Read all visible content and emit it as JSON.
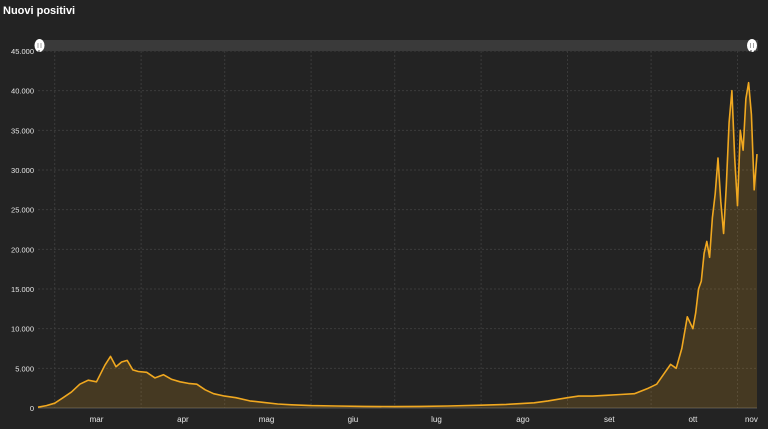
{
  "title": "Nuovi positivi",
  "chart_data": {
    "type": "area",
    "title": "Nuovi positivi",
    "xlabel": "",
    "ylabel": "",
    "x_tick_labels": [
      "mar",
      "apr",
      "mag",
      "giu",
      "lug",
      "ago",
      "set",
      "ott",
      "nov"
    ],
    "y_ticks": [
      0,
      5000,
      10000,
      15000,
      20000,
      25000,
      30000,
      35000,
      40000,
      45000
    ],
    "y_tick_labels": [
      "0",
      "5.000",
      "10.000",
      "15.000",
      "20.000",
      "25.000",
      "30.000",
      "35.000",
      "40.000",
      "45.000"
    ],
    "ylim": [
      0,
      45000
    ],
    "xlim": [
      "2020-02-24",
      "2020-11-08"
    ],
    "grid": true,
    "legend": "none",
    "series": [
      {
        "color": "#f0a820",
        "x": [
          "2020-02-24",
          "2020-02-27",
          "2020-03-01",
          "2020-03-04",
          "2020-03-07",
          "2020-03-10",
          "2020-03-13",
          "2020-03-16",
          "2020-03-19",
          "2020-03-21",
          "2020-03-23",
          "2020-03-25",
          "2020-03-27",
          "2020-03-29",
          "2020-03-31",
          "2020-04-03",
          "2020-04-06",
          "2020-04-09",
          "2020-04-12",
          "2020-04-15",
          "2020-04-18",
          "2020-04-21",
          "2020-04-24",
          "2020-04-27",
          "2020-05-01",
          "2020-05-05",
          "2020-05-10",
          "2020-05-15",
          "2020-05-20",
          "2020-05-25",
          "2020-06-01",
          "2020-06-10",
          "2020-06-20",
          "2020-07-01",
          "2020-07-10",
          "2020-07-20",
          "2020-08-01",
          "2020-08-10",
          "2020-08-20",
          "2020-08-25",
          "2020-09-01",
          "2020-09-05",
          "2020-09-10",
          "2020-09-15",
          "2020-09-20",
          "2020-09-25",
          "2020-09-30",
          "2020-10-03",
          "2020-10-06",
          "2020-10-08",
          "2020-10-10",
          "2020-10-12",
          "2020-10-14",
          "2020-10-16",
          "2020-10-17",
          "2020-10-18",
          "2020-10-19",
          "2020-10-20",
          "2020-10-21",
          "2020-10-22",
          "2020-10-23",
          "2020-10-24",
          "2020-10-25",
          "2020-10-26",
          "2020-10-27",
          "2020-10-28",
          "2020-10-29",
          "2020-10-30",
          "2020-10-31",
          "2020-11-01",
          "2020-11-02",
          "2020-11-03",
          "2020-11-04",
          "2020-11-05",
          "2020-11-06",
          "2020-11-07",
          "2020-11-08"
        ],
        "values": [
          100,
          300,
          600,
          1300,
          2000,
          3000,
          3500,
          3300,
          5400,
          6500,
          5200,
          5800,
          6000,
          4800,
          4600,
          4500,
          3800,
          4200,
          3600,
          3300,
          3100,
          3000,
          2300,
          1800,
          1500,
          1300,
          900,
          700,
          500,
          400,
          300,
          250,
          200,
          180,
          200,
          250,
          350,
          450,
          650,
          900,
          1300,
          1500,
          1500,
          1600,
          1700,
          1800,
          2500,
          3000,
          4500,
          5500,
          5000,
          7500,
          11500,
          10000,
          12000,
          15000,
          16000,
          19500,
          21000,
          19000,
          24000,
          27000,
          31500,
          26000,
          22000,
          28000,
          36000,
          40000,
          31500,
          25500,
          35000,
          32500,
          39000,
          41000,
          37000,
          27500,
          32000
        ]
      }
    ]
  }
}
